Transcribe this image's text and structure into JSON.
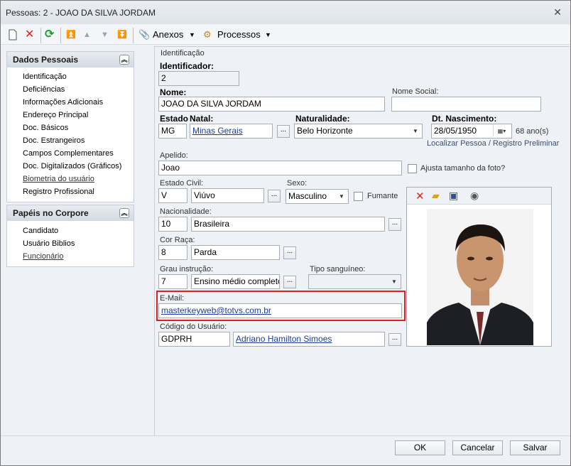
{
  "window": {
    "title": "Pessoas: 2 - JOAO DA SILVA JORDAM"
  },
  "toolbar": {
    "anexos": "Anexos",
    "processos": "Processos"
  },
  "sidebar": {
    "group1": {
      "title": "Dados Pessoais",
      "items": [
        "Identificação",
        "Deficiências",
        "Informações Adicionais",
        "Endereço Principal",
        "Doc. Básicos",
        "Doc. Estrangeiros",
        "Campos Complementares",
        "Doc. Digitalizados (Gráficos)",
        "Biometria do usuário",
        "Registro Profissional"
      ]
    },
    "group2": {
      "title": "Papéis no Corpore",
      "items": [
        "Candidato",
        "Usuário Biblios",
        "Funcionário"
      ]
    }
  },
  "form": {
    "section": "Identificação",
    "identificador_label": "Identificador:",
    "identificador": "2",
    "nome_label": "Nome:",
    "nome": "JOAO DA SILVA JORDAM",
    "nome_social_label": "Nome Social:",
    "nome_social": "",
    "estado_label": "Estado",
    "natal_label": "Natal:",
    "estado": "MG",
    "natal": "Minas Gerais",
    "naturalidade_label": "Naturalidade:",
    "naturalidade": "Belo Horizonte",
    "dt_nasc_label": "Dt. Nascimento:",
    "dt_nasc": "28/05/1950",
    "idade": "68 ano(s)",
    "localizar": "Localizar Pessoa / Registro Preliminar",
    "apelido_label": "Apelido:",
    "apelido": "Joao",
    "ajusta_foto": "Ajusta tamanho da foto?",
    "estado_civil_label": "Estado Civil:",
    "estado_civil_cod": "V",
    "estado_civil": "Viúvo",
    "sexo_label": "Sexo:",
    "sexo": "Masculino",
    "fumante": "Fumante",
    "nacionalidade_label": "Nacionalidade:",
    "nacionalidade_cod": "10",
    "nacionalidade": "Brasileira",
    "cor_raca_label": "Cor Raça:",
    "cor_raca_cod": "8",
    "cor_raca": "Parda",
    "grau_label": "Grau instrução:",
    "grau_cod": "7",
    "grau": "Ensino médio completo",
    "tipo_sang_label": "Tipo sanguíneo:",
    "tipo_sang": "",
    "email_label": "E-Mail:",
    "email": "masterkeyweb@totvs.com.br",
    "codigo_usuario_label": "Código do Usuário:",
    "codigo_usuario": "GDPRH",
    "usuario_nome": "Adriano Hamilton Simoes",
    "dots": "..."
  },
  "buttons": {
    "ok": "OK",
    "cancelar": "Cancelar",
    "salvar": "Salvar"
  },
  "colors": {
    "highlight": "#e02020",
    "link": "#1a3c9c"
  }
}
